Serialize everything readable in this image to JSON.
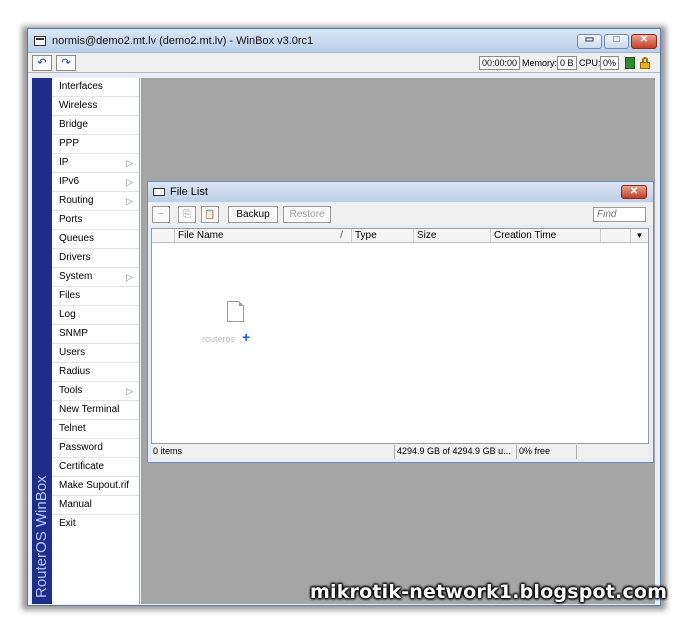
{
  "window": {
    "title": "normis@demo2.mt.lv (demo2.mt.lv) - WinBox v3.0rc1",
    "min_glyph": "▭",
    "max_glyph": "□",
    "close_glyph": "✕"
  },
  "toolbar": {
    "undo_glyph": "↶",
    "redo_glyph": "↷",
    "time": "00:00:00",
    "memory_label": "Memory:",
    "memory_value": "0 B",
    "cpu_label": "CPU:",
    "cpu_value": "0%"
  },
  "sidebar": {
    "brand": "RouterOS WinBox",
    "submenu_glyph": "▷",
    "items": [
      {
        "label": "Interfaces"
      },
      {
        "label": "Wireless"
      },
      {
        "label": "Bridge"
      },
      {
        "label": "PPP"
      },
      {
        "label": "IP"
      },
      {
        "label": "IPv6"
      },
      {
        "label": "Routing"
      },
      {
        "label": "Ports"
      },
      {
        "label": "Queues"
      },
      {
        "label": "Drivers"
      },
      {
        "label": "System"
      },
      {
        "label": "Files"
      },
      {
        "label": "Log"
      },
      {
        "label": "SNMP"
      },
      {
        "label": "Users"
      },
      {
        "label": "Radius"
      },
      {
        "label": "Tools"
      },
      {
        "label": "New Terminal"
      },
      {
        "label": "Telnet"
      },
      {
        "label": "Password"
      },
      {
        "label": "Certificate"
      },
      {
        "label": "Make Supout.rif"
      },
      {
        "label": "Manual"
      },
      {
        "label": "Exit"
      }
    ]
  },
  "file_list": {
    "title": "File List",
    "close_glyph": "✕",
    "toolbar": {
      "minus_glyph": "−",
      "copy_glyph": "⎘",
      "paste_glyph": "📋",
      "backup_label": "Backup",
      "restore_label": "Restore",
      "find_placeholder": "Find"
    },
    "columns": {
      "name": "File Name",
      "sort_glyph": "/",
      "type": "Type",
      "size": "Size",
      "creation_time": "Creation Time",
      "dropdown_glyph": "▼"
    },
    "drag_file_label": "routeros",
    "drag_plus_glyph": "+",
    "status": {
      "items": "0 items",
      "space": "4294.9 GB of 4294.9 GB u...",
      "free": "0% free"
    }
  },
  "watermark": "mikrotik-network1.blogspot.com",
  "colors": {
    "brand_bar": "#1f2d8a",
    "workspace": "#a5a5a5",
    "close_button": "#c2412a"
  }
}
